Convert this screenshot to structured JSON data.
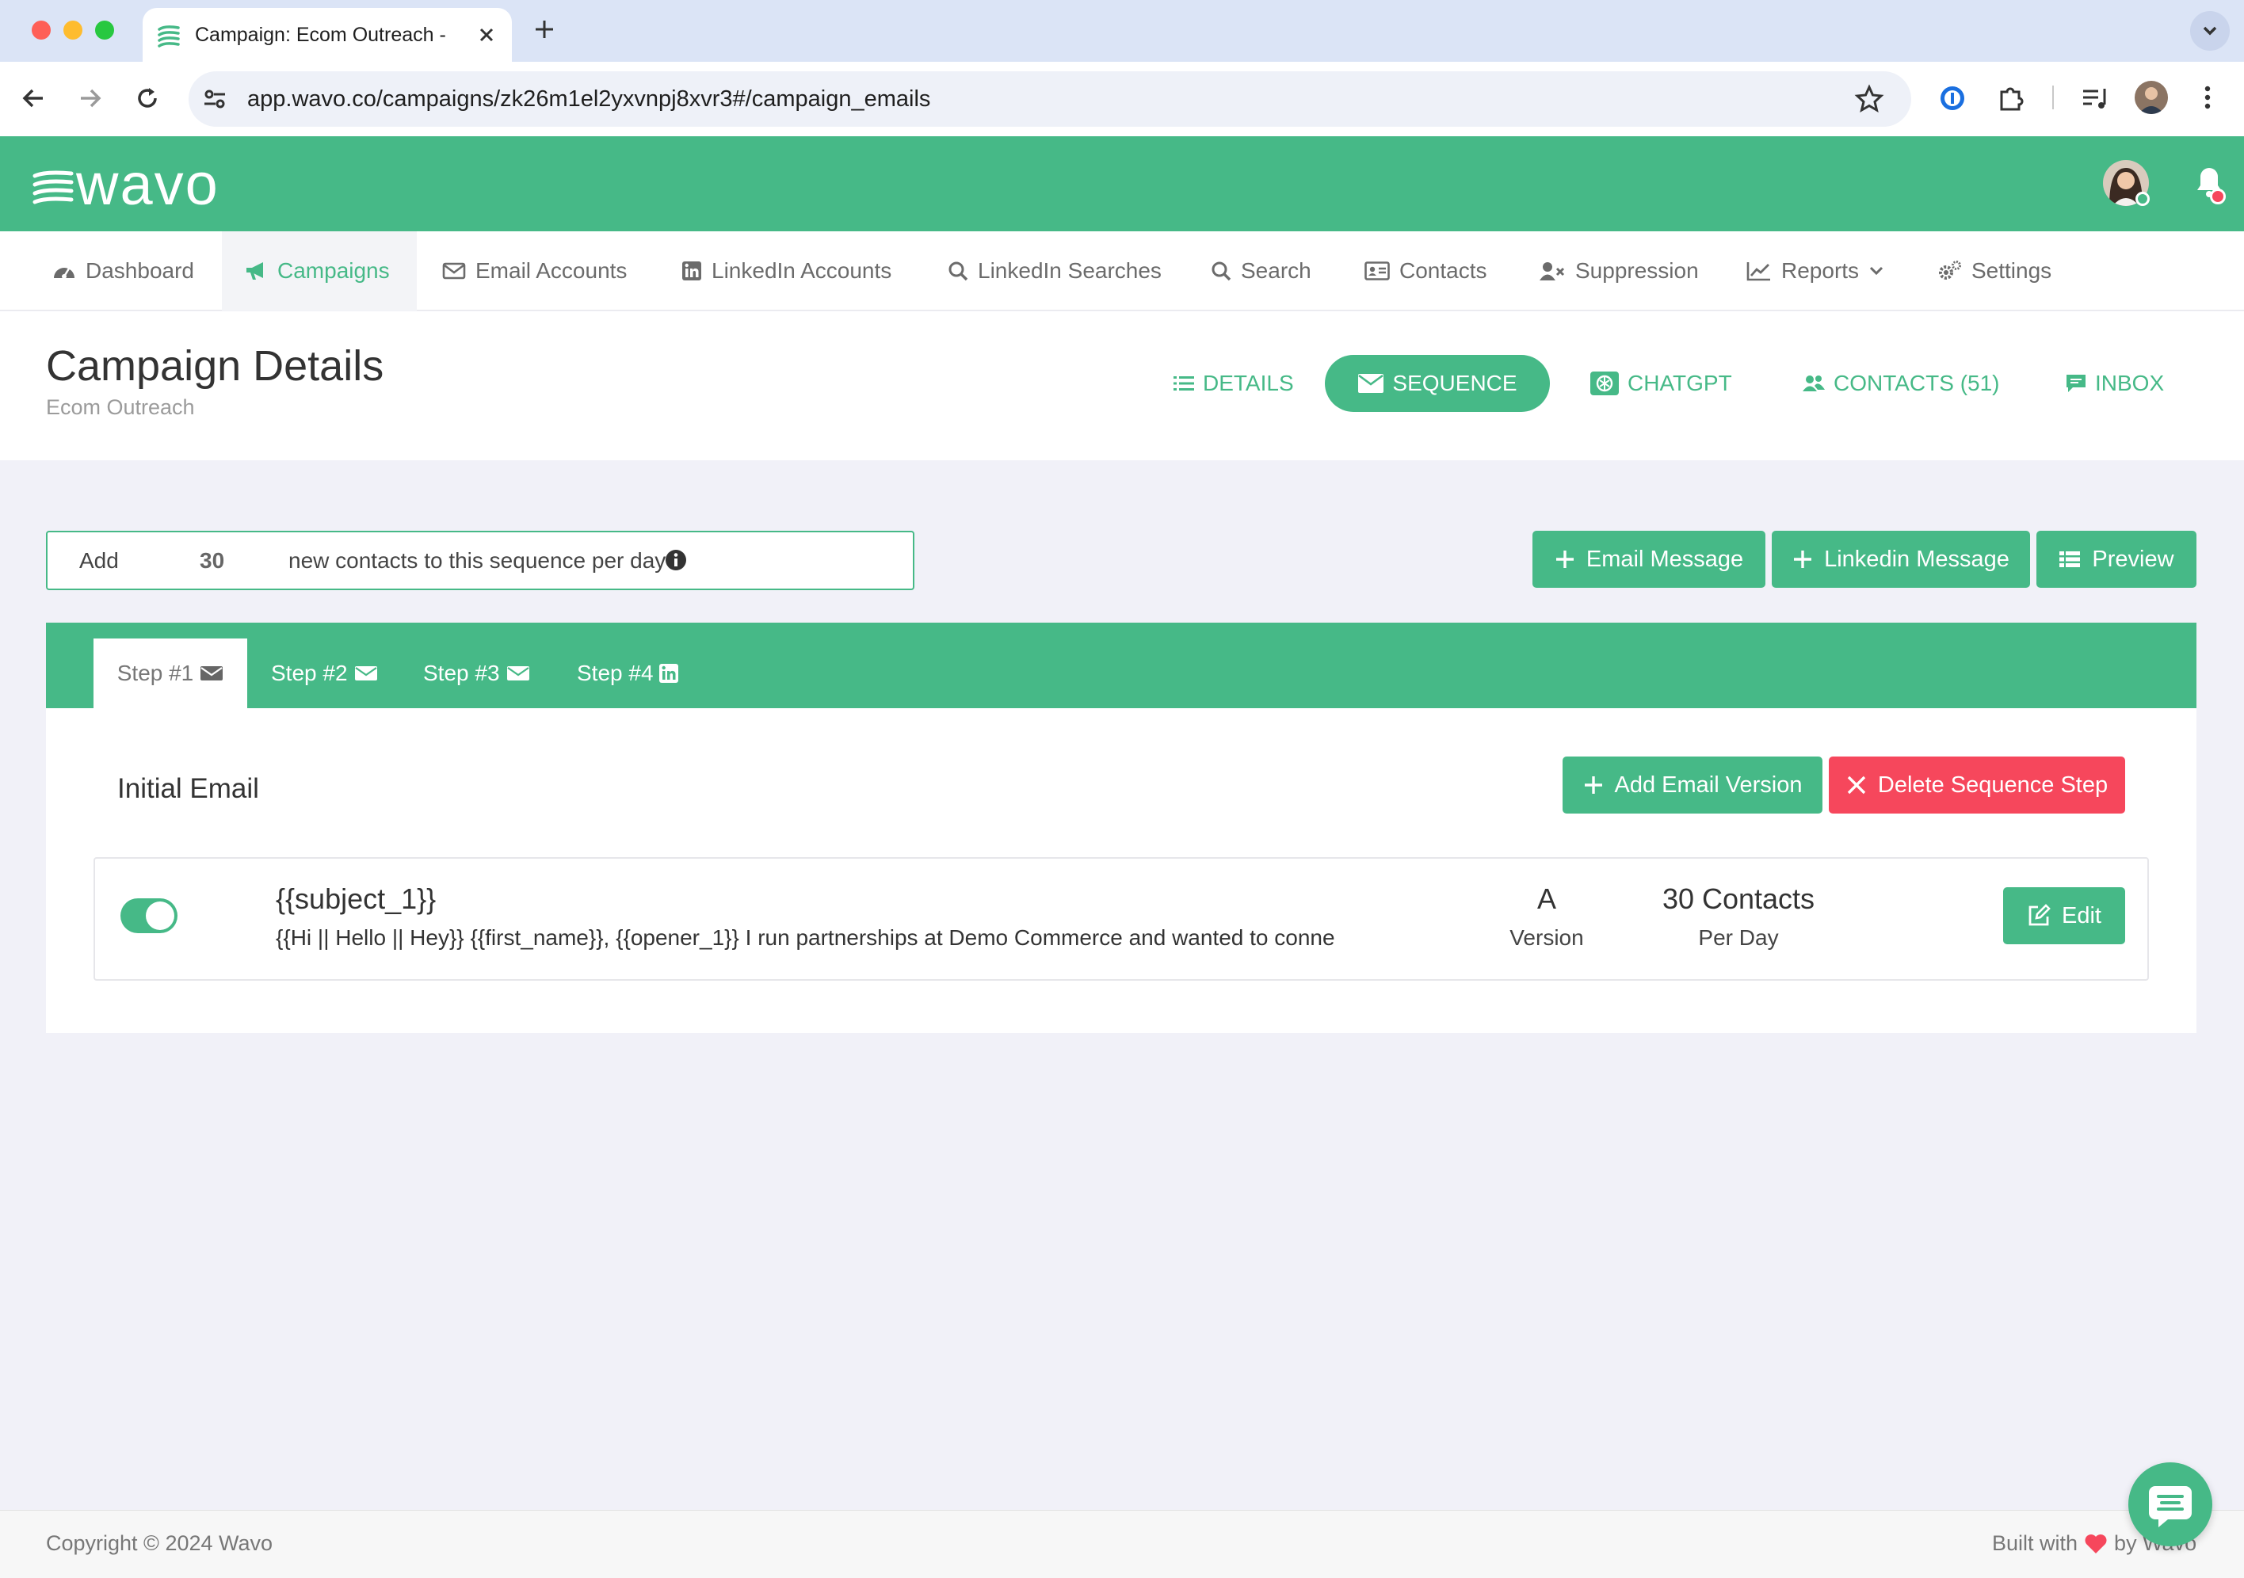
{
  "browser": {
    "tab_title": "Campaign: Ecom Outreach - W",
    "url": "app.wavo.co/campaigns/zk26m1el2yxvnpj8xvr3#/campaign_emails"
  },
  "brand": {
    "logo_text": "wavo",
    "accent": "#46b987",
    "danger": "#f6475c"
  },
  "nav": {
    "items": [
      {
        "label": "Dashboard",
        "icon": "dashboard-icon"
      },
      {
        "label": "Campaigns",
        "icon": "megaphone-icon",
        "active": true
      },
      {
        "label": "Email Accounts",
        "icon": "envelope-icon"
      },
      {
        "label": "LinkedIn Accounts",
        "icon": "linkedin-icon"
      },
      {
        "label": "LinkedIn Searches",
        "icon": "search-icon"
      },
      {
        "label": "Search",
        "icon": "search-icon"
      },
      {
        "label": "Contacts",
        "icon": "address-card-icon"
      },
      {
        "label": "Suppression",
        "icon": "user-times-icon"
      },
      {
        "label": "Reports",
        "icon": "chart-line-icon"
      },
      {
        "label": "Settings",
        "icon": "cogs-icon"
      }
    ]
  },
  "page": {
    "title": "Campaign Details",
    "subtitle": "Ecom Outreach"
  },
  "page_tabs": {
    "details": "DETAILS",
    "sequence": "SEQUENCE",
    "chatgpt": "CHATGPT",
    "contacts": "CONTACTS (51)",
    "inbox": "INBOX"
  },
  "daily_limit": {
    "prefix": "Add",
    "value": "30",
    "suffix": "new contacts to this sequence per day"
  },
  "actions": {
    "email_message": "Email Message",
    "linkedin_message": "Linkedin Message",
    "preview": "Preview"
  },
  "steps": [
    {
      "label": "Step #1",
      "icon": "envelope-icon",
      "active": true
    },
    {
      "label": "Step #2",
      "icon": "envelope-icon"
    },
    {
      "label": "Step #3",
      "icon": "envelope-icon"
    },
    {
      "label": "Step #4",
      "icon": "linkedin-icon"
    }
  ],
  "step_panel": {
    "title": "Initial Email",
    "add_version": "Add Email Version",
    "delete_step": "Delete Sequence Step"
  },
  "email_version": {
    "enabled": true,
    "subject": "{{subject_1}}",
    "preview": "{{Hi || Hello || Hey}} {{first_name}}, {{opener_1}} I run partnerships at Demo Commerce and wanted to conne",
    "version_letter": "A",
    "version_label": "Version",
    "contacts": "30 Contacts",
    "contacts_label": "Per Day",
    "edit_label": "Edit"
  },
  "footer": {
    "copyright": "Copyright © 2024 Wavo",
    "built_prefix": "Built with",
    "built_suffix": "by Wavo"
  }
}
